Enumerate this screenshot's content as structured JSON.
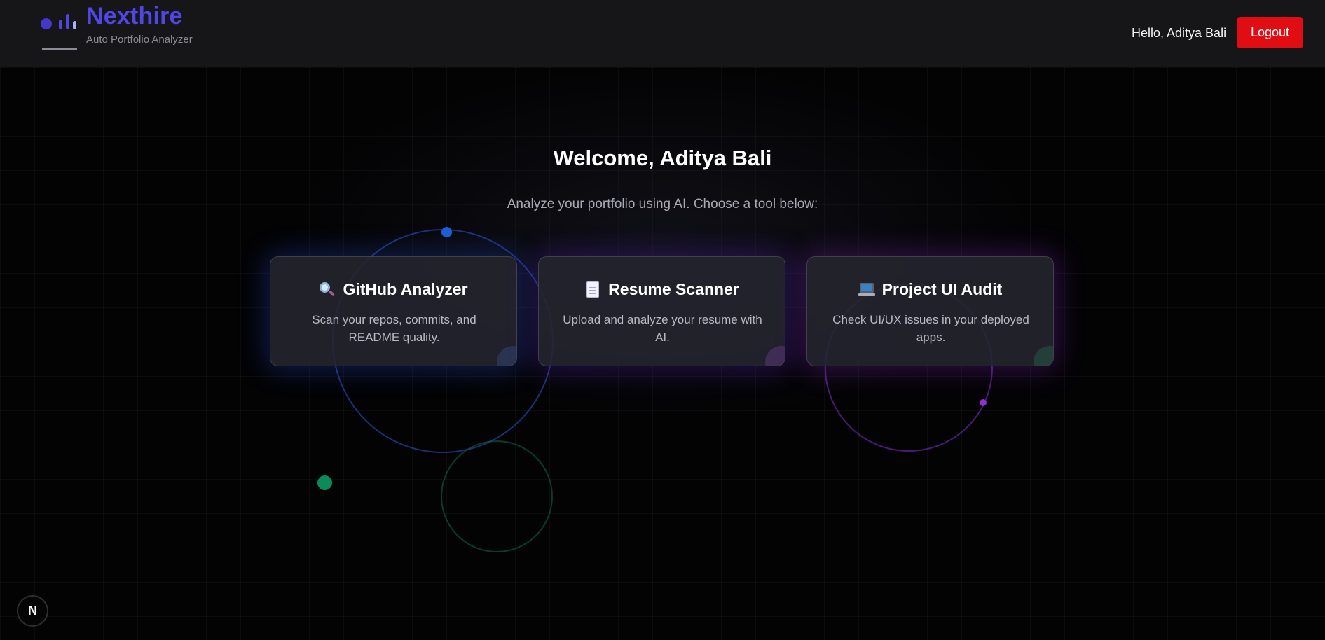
{
  "header": {
    "brand_name": "Nexthire",
    "brand_tagline": "Auto Portfolio Analyzer",
    "greeting": "Hello, Aditya Bali",
    "logout_label": "Logout"
  },
  "main": {
    "welcome": "Welcome, Aditya Bali",
    "subtitle": "Analyze your portfolio using AI. Choose a tool below:",
    "tools": [
      {
        "icon": "magnifying-glass-icon",
        "title": "GitHub Analyzer",
        "description": "Scan your repos, commits, and README quality."
      },
      {
        "icon": "page-icon",
        "title": "Resume Scanner",
        "description": "Upload and analyze your resume with AI."
      },
      {
        "icon": "laptop-icon",
        "title": "Project UI Audit",
        "description": "Check UI/UX issues in your deployed apps."
      }
    ]
  },
  "dev_badge": {
    "label": "N"
  },
  "colors": {
    "brand": "#4f46e5",
    "logout": "#e00d13",
    "background": "#030304",
    "header": "#161618"
  }
}
